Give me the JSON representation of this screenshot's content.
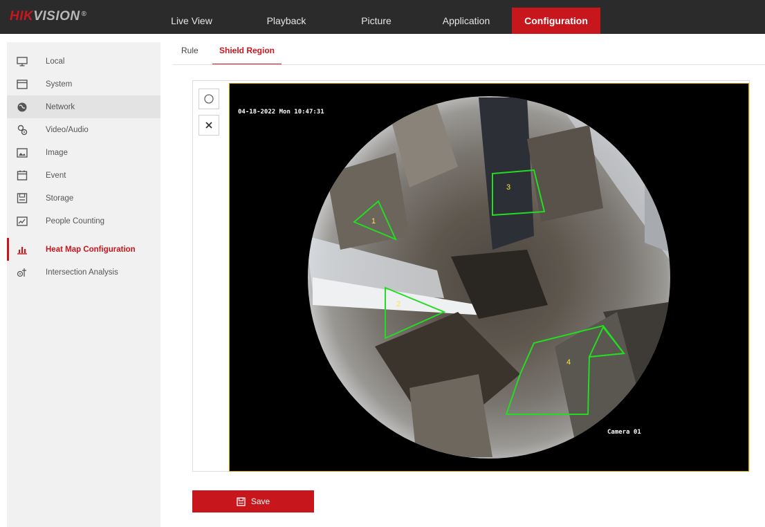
{
  "brand": {
    "hik": "HIK",
    "vision": "VISION",
    "reg": "®"
  },
  "nav": {
    "live_view": "Live View",
    "playback": "Playback",
    "picture": "Picture",
    "application": "Application",
    "configuration": "Configuration"
  },
  "sidebar": {
    "items": [
      {
        "label": "Local",
        "icon": "monitor-icon"
      },
      {
        "label": "System",
        "icon": "system-icon"
      },
      {
        "label": "Network",
        "icon": "globe-icon"
      },
      {
        "label": "Video/Audio",
        "icon": "video-audio-icon"
      },
      {
        "label": "Image",
        "icon": "image-icon"
      },
      {
        "label": "Event",
        "icon": "calendar-icon"
      },
      {
        "label": "Storage",
        "icon": "storage-icon"
      },
      {
        "label": "People Counting",
        "icon": "people-counting-icon"
      },
      {
        "label": "Heat Map Configuration",
        "icon": "heat-map-icon"
      },
      {
        "label": "Intersection Analysis",
        "icon": "intersection-icon"
      }
    ]
  },
  "tabs": {
    "rule": "Rule",
    "shield_region": "Shield Region"
  },
  "video": {
    "timestamp": "04-18-2022 Mon 10:47:31",
    "camera_name": "Camera 01",
    "regions": [
      {
        "number": "1"
      },
      {
        "number": "2"
      },
      {
        "number": "3"
      },
      {
        "number": "4"
      }
    ]
  },
  "toolbar": {
    "draw_icon": "circle-icon",
    "clear_icon": "close-icon"
  },
  "save_label": "Save",
  "colors": {
    "accent": "#c8161d",
    "region": "#22dd22",
    "topbar": "#2b2b2b",
    "sidebar": "#f1f1f1"
  }
}
